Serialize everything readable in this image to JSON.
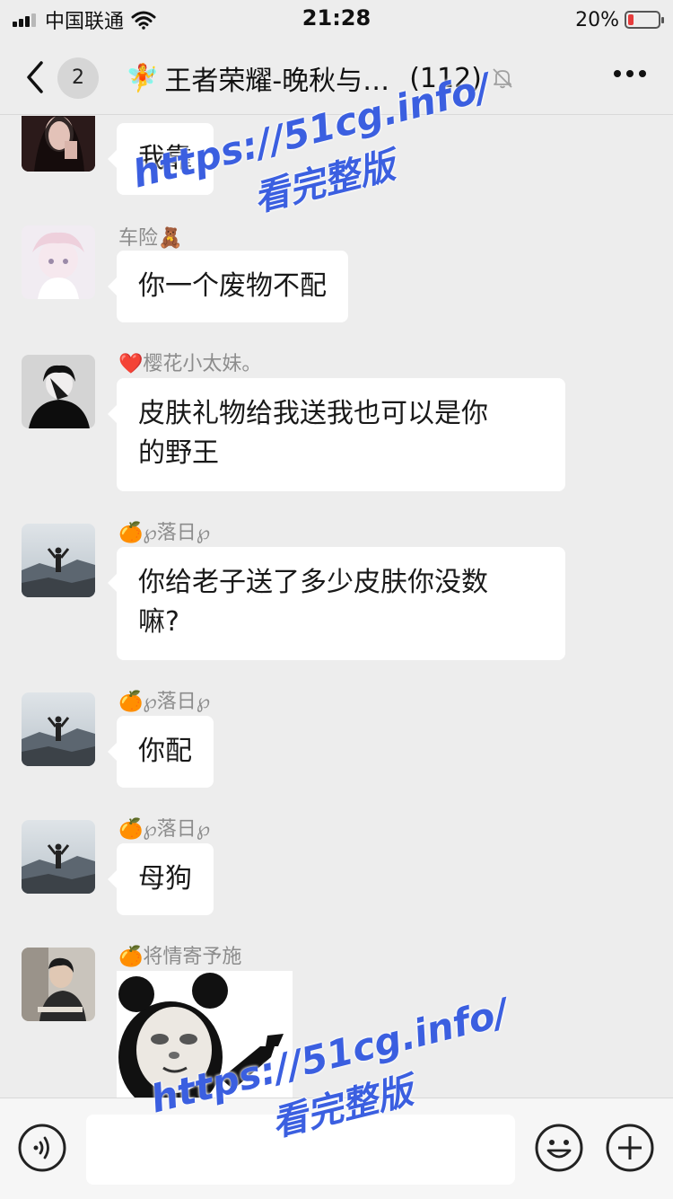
{
  "status_bar": {
    "carrier": "中国联通",
    "time": "21:28",
    "battery_text": "20%",
    "battery_level": 0.2
  },
  "header": {
    "back_badge": "2",
    "title_emoji": "🧚",
    "title": "王者荣耀-晚秋与…",
    "member_count": "(112)"
  },
  "messages": [
    {
      "sender": "",
      "text": "我靠"
    },
    {
      "sender": "车险🧸",
      "text": "你一个废物不配"
    },
    {
      "sender": "❤️樱花小太妹。",
      "text_lines": [
        "皮肤礼物给我送我也可以是你",
        "的野王"
      ]
    },
    {
      "sender": "🍊℘落日℘",
      "text_lines": [
        "你给老子送了多少皮肤你没数",
        "嘛?"
      ]
    },
    {
      "sender": "🍊℘落日℘",
      "text": "你配"
    },
    {
      "sender": "🍊℘落日℘",
      "text": "母狗"
    },
    {
      "sender": "🍊将情寄予施",
      "sticker": "panda-meme-sticker"
    }
  ],
  "watermarks": [
    {
      "url": "https://51cg.info/",
      "sub": "看完整版"
    },
    {
      "url": "https://51cg.info/",
      "sub": "看完整版"
    }
  ],
  "colors": {
    "background": "#ededed",
    "bubble": "#ffffff",
    "watermark": "#3b5fe0",
    "battery_low": "#e63c3c"
  }
}
